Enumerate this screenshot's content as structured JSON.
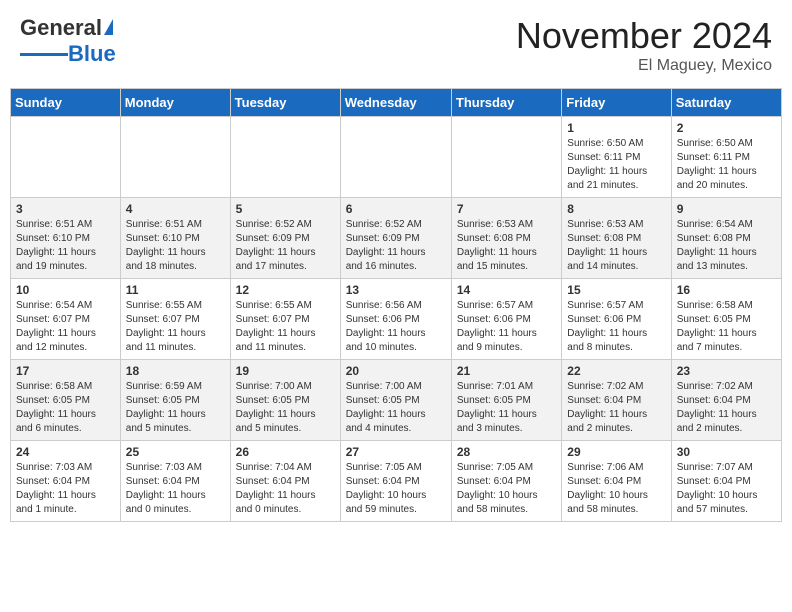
{
  "header": {
    "logo_general": "General",
    "logo_blue": "Blue",
    "title": "November 2024",
    "subtitle": "El Maguey, Mexico"
  },
  "days_of_week": [
    "Sunday",
    "Monday",
    "Tuesday",
    "Wednesday",
    "Thursday",
    "Friday",
    "Saturday"
  ],
  "weeks": [
    {
      "days": [
        {
          "num": "",
          "info": ""
        },
        {
          "num": "",
          "info": ""
        },
        {
          "num": "",
          "info": ""
        },
        {
          "num": "",
          "info": ""
        },
        {
          "num": "",
          "info": ""
        },
        {
          "num": "1",
          "info": "Sunrise: 6:50 AM\nSunset: 6:11 PM\nDaylight: 11 hours\nand 21 minutes."
        },
        {
          "num": "2",
          "info": "Sunrise: 6:50 AM\nSunset: 6:11 PM\nDaylight: 11 hours\nand 20 minutes."
        }
      ]
    },
    {
      "days": [
        {
          "num": "3",
          "info": "Sunrise: 6:51 AM\nSunset: 6:10 PM\nDaylight: 11 hours\nand 19 minutes."
        },
        {
          "num": "4",
          "info": "Sunrise: 6:51 AM\nSunset: 6:10 PM\nDaylight: 11 hours\nand 18 minutes."
        },
        {
          "num": "5",
          "info": "Sunrise: 6:52 AM\nSunset: 6:09 PM\nDaylight: 11 hours\nand 17 minutes."
        },
        {
          "num": "6",
          "info": "Sunrise: 6:52 AM\nSunset: 6:09 PM\nDaylight: 11 hours\nand 16 minutes."
        },
        {
          "num": "7",
          "info": "Sunrise: 6:53 AM\nSunset: 6:08 PM\nDaylight: 11 hours\nand 15 minutes."
        },
        {
          "num": "8",
          "info": "Sunrise: 6:53 AM\nSunset: 6:08 PM\nDaylight: 11 hours\nand 14 minutes."
        },
        {
          "num": "9",
          "info": "Sunrise: 6:54 AM\nSunset: 6:08 PM\nDaylight: 11 hours\nand 13 minutes."
        }
      ]
    },
    {
      "days": [
        {
          "num": "10",
          "info": "Sunrise: 6:54 AM\nSunset: 6:07 PM\nDaylight: 11 hours\nand 12 minutes."
        },
        {
          "num": "11",
          "info": "Sunrise: 6:55 AM\nSunset: 6:07 PM\nDaylight: 11 hours\nand 11 minutes."
        },
        {
          "num": "12",
          "info": "Sunrise: 6:55 AM\nSunset: 6:07 PM\nDaylight: 11 hours\nand 11 minutes."
        },
        {
          "num": "13",
          "info": "Sunrise: 6:56 AM\nSunset: 6:06 PM\nDaylight: 11 hours\nand 10 minutes."
        },
        {
          "num": "14",
          "info": "Sunrise: 6:57 AM\nSunset: 6:06 PM\nDaylight: 11 hours\nand 9 minutes."
        },
        {
          "num": "15",
          "info": "Sunrise: 6:57 AM\nSunset: 6:06 PM\nDaylight: 11 hours\nand 8 minutes."
        },
        {
          "num": "16",
          "info": "Sunrise: 6:58 AM\nSunset: 6:05 PM\nDaylight: 11 hours\nand 7 minutes."
        }
      ]
    },
    {
      "days": [
        {
          "num": "17",
          "info": "Sunrise: 6:58 AM\nSunset: 6:05 PM\nDaylight: 11 hours\nand 6 minutes."
        },
        {
          "num": "18",
          "info": "Sunrise: 6:59 AM\nSunset: 6:05 PM\nDaylight: 11 hours\nand 5 minutes."
        },
        {
          "num": "19",
          "info": "Sunrise: 7:00 AM\nSunset: 6:05 PM\nDaylight: 11 hours\nand 5 minutes."
        },
        {
          "num": "20",
          "info": "Sunrise: 7:00 AM\nSunset: 6:05 PM\nDaylight: 11 hours\nand 4 minutes."
        },
        {
          "num": "21",
          "info": "Sunrise: 7:01 AM\nSunset: 6:05 PM\nDaylight: 11 hours\nand 3 minutes."
        },
        {
          "num": "22",
          "info": "Sunrise: 7:02 AM\nSunset: 6:04 PM\nDaylight: 11 hours\nand 2 minutes."
        },
        {
          "num": "23",
          "info": "Sunrise: 7:02 AM\nSunset: 6:04 PM\nDaylight: 11 hours\nand 2 minutes."
        }
      ]
    },
    {
      "days": [
        {
          "num": "24",
          "info": "Sunrise: 7:03 AM\nSunset: 6:04 PM\nDaylight: 11 hours\nand 1 minute."
        },
        {
          "num": "25",
          "info": "Sunrise: 7:03 AM\nSunset: 6:04 PM\nDaylight: 11 hours\nand 0 minutes."
        },
        {
          "num": "26",
          "info": "Sunrise: 7:04 AM\nSunset: 6:04 PM\nDaylight: 11 hours\nand 0 minutes."
        },
        {
          "num": "27",
          "info": "Sunrise: 7:05 AM\nSunset: 6:04 PM\nDaylight: 10 hours\nand 59 minutes."
        },
        {
          "num": "28",
          "info": "Sunrise: 7:05 AM\nSunset: 6:04 PM\nDaylight: 10 hours\nand 58 minutes."
        },
        {
          "num": "29",
          "info": "Sunrise: 7:06 AM\nSunset: 6:04 PM\nDaylight: 10 hours\nand 58 minutes."
        },
        {
          "num": "30",
          "info": "Sunrise: 7:07 AM\nSunset: 6:04 PM\nDaylight: 10 hours\nand 57 minutes."
        }
      ]
    }
  ]
}
